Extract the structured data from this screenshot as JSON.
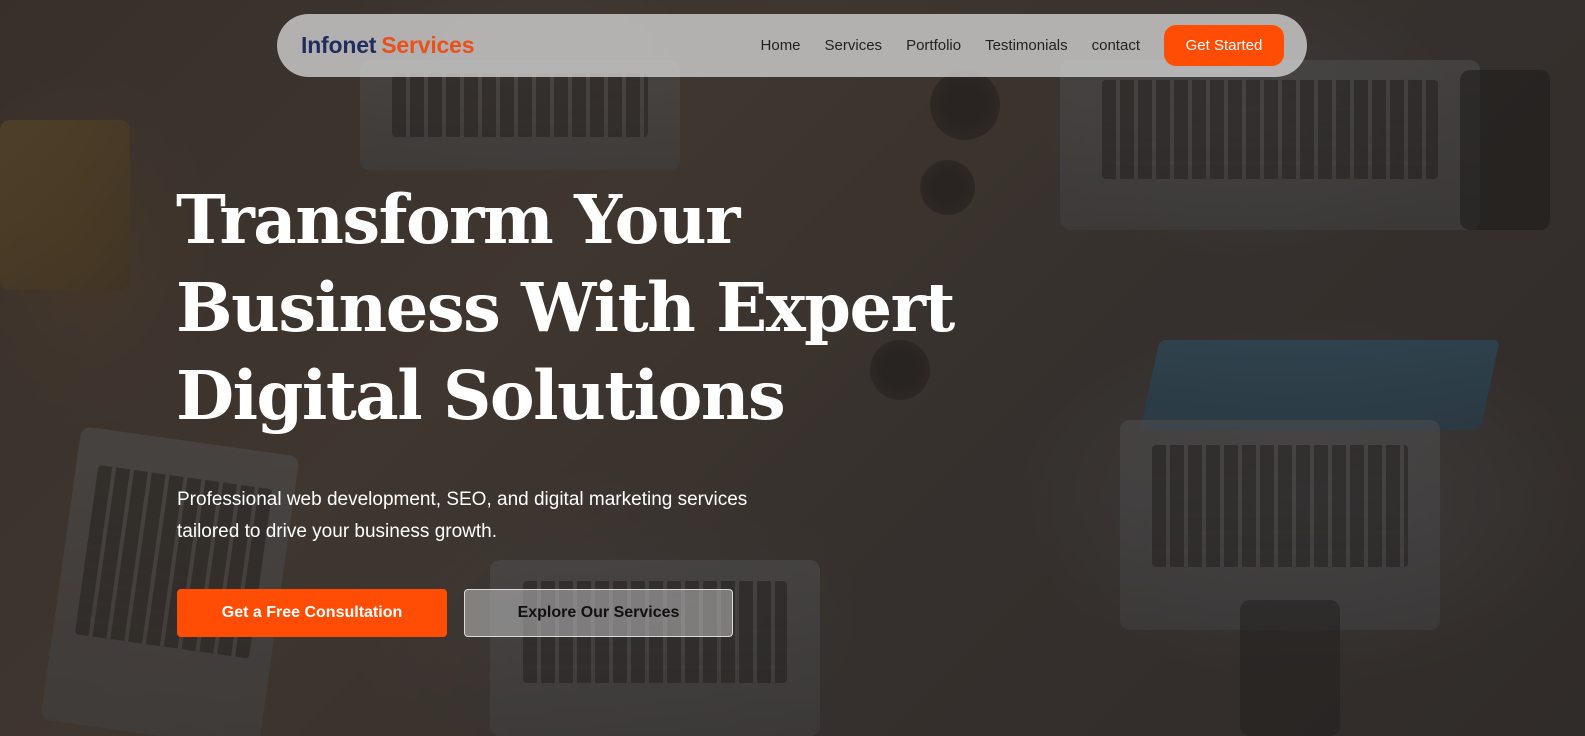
{
  "brand": {
    "name_part1": "Infonet",
    "name_part2": "Services",
    "colors": {
      "navy": "#232c5e",
      "orange": "#e8501c",
      "accent": "#ff4d05"
    }
  },
  "nav": {
    "links": [
      {
        "label": "Home"
      },
      {
        "label": "Services"
      },
      {
        "label": "Portfolio"
      },
      {
        "label": "Testimonials"
      },
      {
        "label": "contact"
      }
    ],
    "cta_label": "Get Started"
  },
  "hero": {
    "title_lines": [
      "Transform Your",
      "Business With Expert",
      "Digital Solutions"
    ],
    "subtitle_lines": [
      "Professional web development, SEO, and digital marketing services",
      "tailored to drive your business growth."
    ],
    "primary_button": "Get a Free Consultation",
    "secondary_button": "Explore Our Services"
  }
}
